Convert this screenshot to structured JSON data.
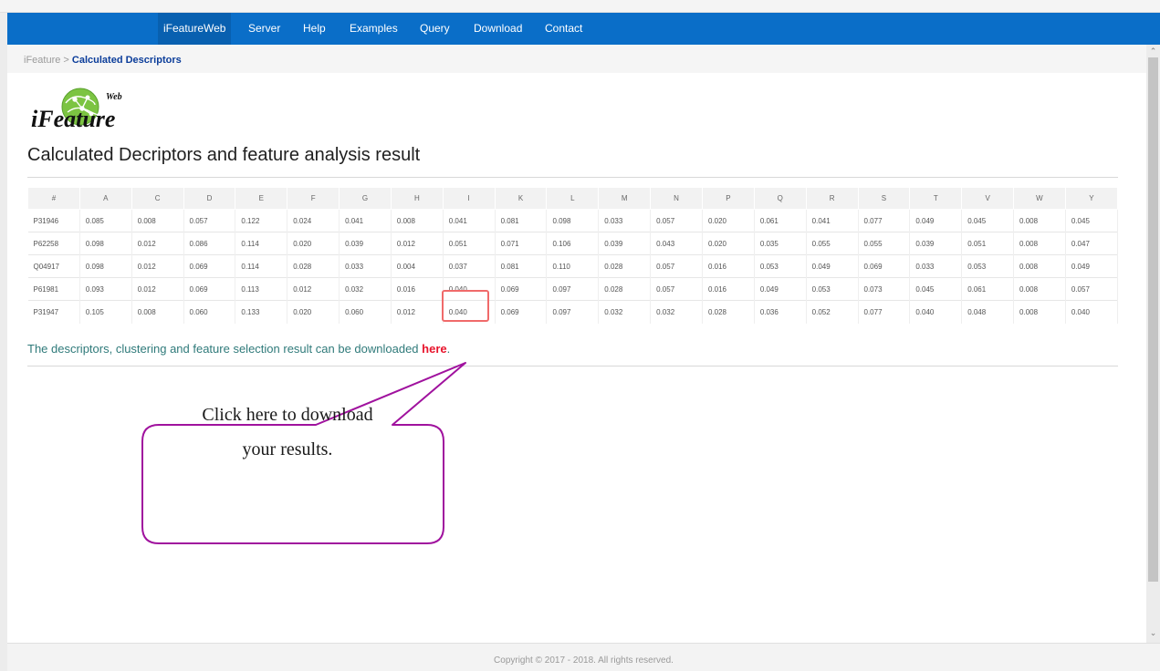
{
  "nav": {
    "items": [
      "iFeatureWeb",
      "Server",
      "Help",
      "Examples",
      "Query",
      "Download",
      "Contact"
    ]
  },
  "breadcrumb": {
    "root": "iFeature",
    "separator": ">",
    "current": "Calculated Descriptors"
  },
  "logo": {
    "main_text": "iFeature",
    "sub_text": "Web"
  },
  "page": {
    "title": "Calculated Decriptors and feature analysis result"
  },
  "table": {
    "headers": [
      "#",
      "A",
      "C",
      "D",
      "E",
      "F",
      "G",
      "H",
      "I",
      "K",
      "L",
      "M",
      "N",
      "P",
      "Q",
      "R",
      "S",
      "T",
      "V",
      "W",
      "Y"
    ],
    "rows": [
      [
        "P31946",
        "0.085",
        "0.008",
        "0.057",
        "0.122",
        "0.024",
        "0.041",
        "0.008",
        "0.041",
        "0.081",
        "0.098",
        "0.033",
        "0.057",
        "0.020",
        "0.061",
        "0.041",
        "0.077",
        "0.049",
        "0.045",
        "0.008",
        "0.045"
      ],
      [
        "P62258",
        "0.098",
        "0.012",
        "0.086",
        "0.114",
        "0.020",
        "0.039",
        "0.012",
        "0.051",
        "0.071",
        "0.106",
        "0.039",
        "0.043",
        "0.020",
        "0.035",
        "0.055",
        "0.055",
        "0.039",
        "0.051",
        "0.008",
        "0.047"
      ],
      [
        "Q04917",
        "0.098",
        "0.012",
        "0.069",
        "0.114",
        "0.028",
        "0.033",
        "0.004",
        "0.037",
        "0.081",
        "0.110",
        "0.028",
        "0.057",
        "0.016",
        "0.053",
        "0.049",
        "0.069",
        "0.033",
        "0.053",
        "0.008",
        "0.049"
      ],
      [
        "P61981",
        "0.093",
        "0.012",
        "0.069",
        "0.113",
        "0.012",
        "0.032",
        "0.016",
        "0.040",
        "0.069",
        "0.097",
        "0.028",
        "0.057",
        "0.016",
        "0.049",
        "0.053",
        "0.073",
        "0.045",
        "0.061",
        "0.008",
        "0.057"
      ],
      [
        "P31947",
        "0.105",
        "0.008",
        "0.060",
        "0.133",
        "0.020",
        "0.060",
        "0.012",
        "0.040",
        "0.069",
        "0.097",
        "0.032",
        "0.032",
        "0.028",
        "0.036",
        "0.052",
        "0.077",
        "0.040",
        "0.048",
        "0.008",
        "0.040"
      ]
    ]
  },
  "download": {
    "text": "The descriptors, clustering and feature selection result can be downloaded",
    "link_label": "here",
    "suffix": "."
  },
  "callout": {
    "line1": "Click here to download",
    "line2": "your results."
  },
  "footer": {
    "copyright": "Copyright © 2017 - 2018. All rights reserved."
  },
  "colors": {
    "nav_bg": "#0a6ec8",
    "breadcrumb_current": "#0b3d9a",
    "download_text": "#2f7a7a",
    "link": "#e8142c",
    "callout_border": "#a0129e",
    "highlight_box": "#f06a6a"
  }
}
